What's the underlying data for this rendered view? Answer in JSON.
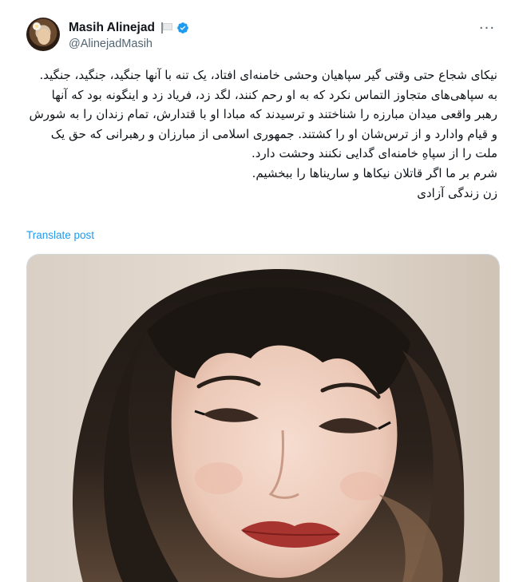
{
  "author": {
    "display_name": "Masih Alinejad",
    "handle": "@AlinejadMasih",
    "verified": true,
    "avatar_icon": "avatar-photo",
    "flag_icon": "white-flag-icon"
  },
  "menu": {
    "more_icon": "more-horizontal-icon",
    "more_glyph": "···"
  },
  "tweet": {
    "paragraphs": [
      "نیکای شجاع حتی وقتی گیر سپاهیان وحشی خامنه‌ای افتاد، یک تنه با آنها جنگید، جنگید، جنگید. به سپاهی‌های متجاوز التماس نکرد که به او رحم کنند، لگد زد، فریاد زد و اینگونه بود که آنها رهبر واقعی میدان مبارزه را شناختند و ترسیدند که مبادا او با قتدارش، تمام زندان را به شورش و قیام وادارد و از ترس‌شان او را کشتند. جمهوری اسلامی از مبارزان و رهبرانی که حق یک ملت را از سپاهِ خامنه‌ای گدایی نکنند وحشت دارد.",
      "شرم بر ما اگر قاتلان نیکاها و سارینا‌ها را ببخشیم.",
      "زن زندگی آزادی"
    ],
    "translate_label": "Translate post"
  },
  "colors": {
    "text": "#0f1419",
    "secondary": "#536471",
    "link": "#1d9bf0",
    "verified": "#1d9bf0",
    "border": "#cfd9de"
  },
  "media": {
    "type": "photo",
    "subject": "portrait"
  }
}
